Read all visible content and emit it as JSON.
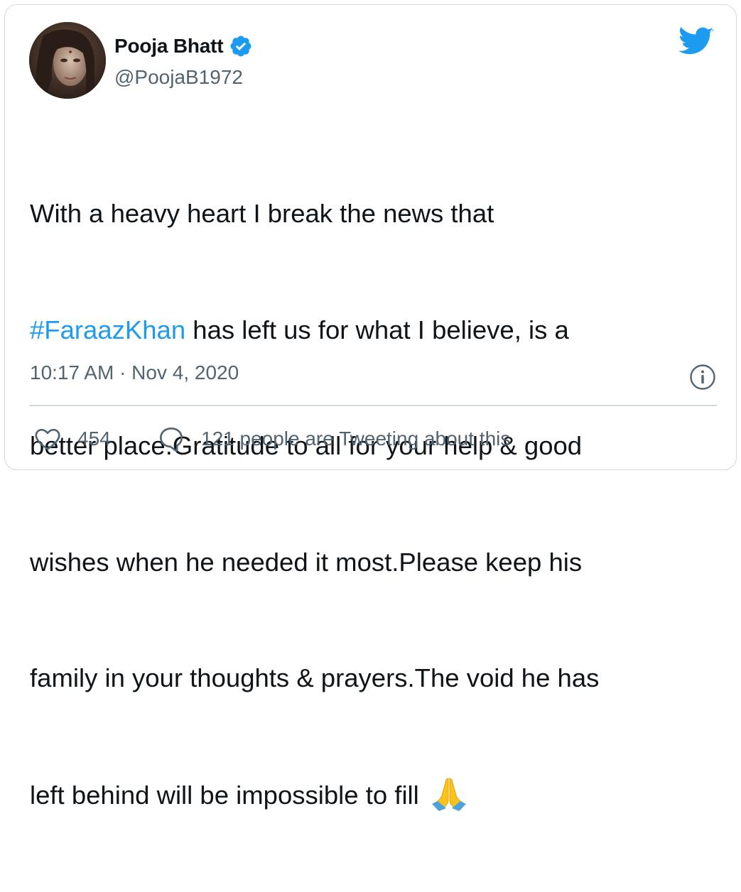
{
  "author": {
    "name": "Pooja Bhatt",
    "handle": "@PoojaB1972",
    "verified": true
  },
  "tweet": {
    "lines": [
      {
        "before": "With a heavy heart I break the news that",
        "hashtag": "",
        "after": ""
      },
      {
        "before": "",
        "hashtag": "#FaraazKhan",
        "after": " has left us for what I believe, is a"
      },
      {
        "before": "better place.Gratitude to all for your help & good",
        "hashtag": "",
        "after": ""
      },
      {
        "before": "wishes when he needed it most.Please keep his",
        "hashtag": "",
        "after": ""
      },
      {
        "before": "family in your thoughts & prayers.The void he has",
        "hashtag": "",
        "after": ""
      },
      {
        "before": "left behind will be impossible to fill ",
        "hashtag": "",
        "after": ""
      }
    ],
    "emoji": "folded-hands"
  },
  "meta": {
    "timestamp": "10:17 AM · Nov 4, 2020"
  },
  "actions": {
    "like_count": "454",
    "reply_text": "121 people are Tweeting about this"
  },
  "colors": {
    "accent": "#1d9bf0",
    "text": "#0f1419",
    "secondary": "#536471",
    "border": "#cfd9de"
  },
  "icons": {
    "brand": "twitter-bird-icon",
    "verified": "verified-badge-icon",
    "info": "info-icon",
    "like": "heart-icon",
    "reply": "speech-bubble-icon"
  }
}
